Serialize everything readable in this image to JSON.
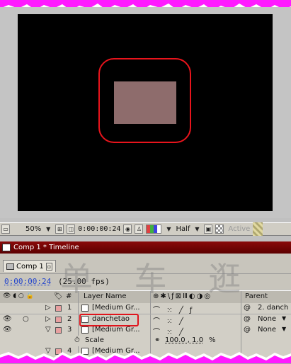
{
  "viewer_toolbar": {
    "zoom": "50%",
    "time": "0:00:00:24",
    "resolution": "Half",
    "camera": "Active"
  },
  "timeline": {
    "window_title": "Comp 1 * Timeline",
    "comp_tab": "Comp 1",
    "current_time": "0:00:00:24",
    "fps": "(25.00 fps)",
    "columns": {
      "number": "#",
      "layer_name": "Layer Name",
      "parent": "Parent"
    },
    "rows": [
      {
        "num": "1",
        "name": "[Medium Gr...",
        "parent": "2. danch"
      },
      {
        "num": "2",
        "name": "danchetao",
        "parent": "None"
      },
      {
        "num": "3",
        "name": "[Medium Gr...",
        "parent": "None"
      },
      {
        "num": "",
        "name": "Scale",
        "value": "100.0 , 1.0",
        "unit": "%"
      },
      {
        "num": "4",
        "name": "[Medium Gr...",
        "parent": ""
      }
    ]
  },
  "watermark": "单 车 逛",
  "colors": {
    "highlight": "#e8141c",
    "solid": "#8e6c6c",
    "title_bar": "#8a0a0a",
    "torn_edge": "#ff00ff"
  }
}
